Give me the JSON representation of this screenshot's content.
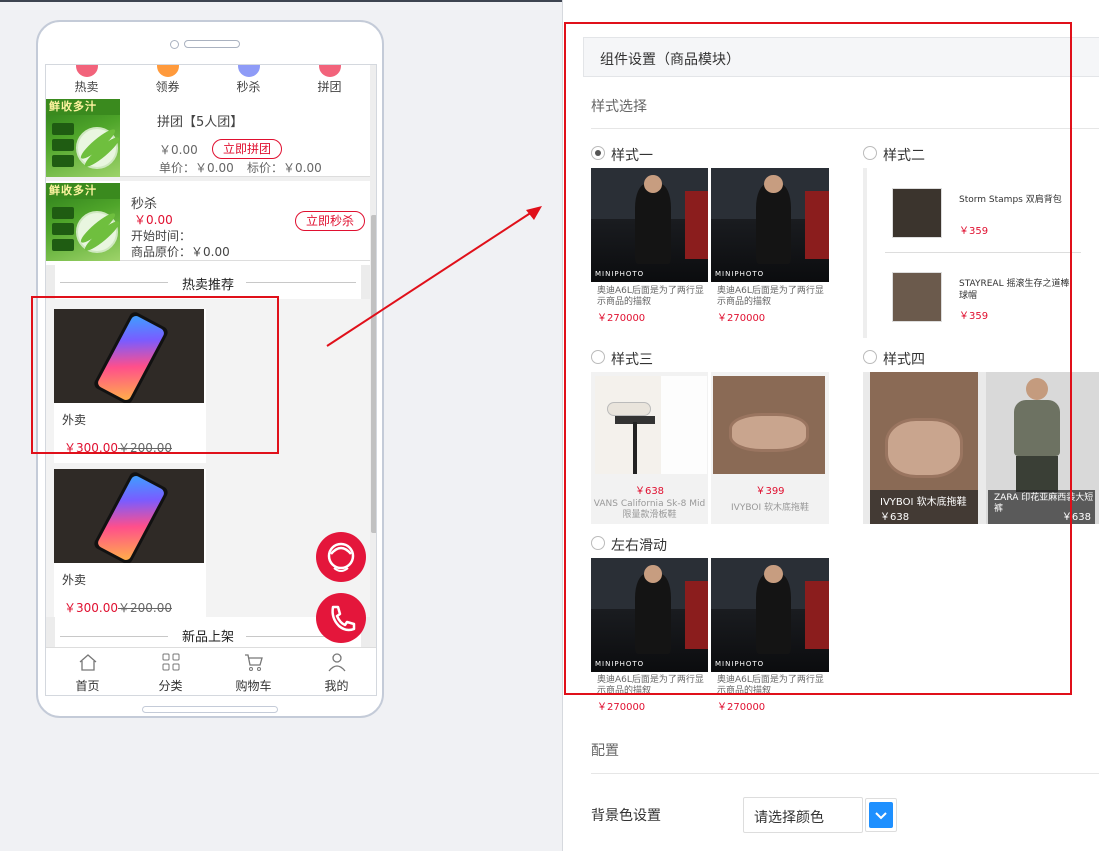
{
  "phone": {
    "top_nav": [
      {
        "label": "热卖",
        "color": "#f2637b"
      },
      {
        "label": "领券",
        "color": "#ff9a3c"
      },
      {
        "label": "秒杀",
        "color": "#8e9bf7"
      },
      {
        "label": "拼团",
        "color": "#f2637b"
      }
    ],
    "promo": {
      "group": {
        "image_text": "鲜收多汁",
        "title": "拼团【5人团】",
        "price": "￥0.00",
        "button": "立即拼团",
        "unit_price": "单价：￥0.00",
        "tag_price": "标价：￥0.00"
      },
      "flash": {
        "image_text": "鲜收多汁",
        "title": "秒杀",
        "price": "￥0.00",
        "start_time": "开始时间：",
        "original_price": "商品原价：￥0.00",
        "button": "立即秒杀"
      }
    },
    "section_hot": "热卖推荐",
    "goods": [
      {
        "name": "外卖",
        "price": "￥300.00",
        "old_price": "￥200.00"
      },
      {
        "name": "外卖",
        "price": "￥300.00",
        "old_price": "￥200.00"
      }
    ],
    "section_new": "新品上架",
    "tabbar": [
      {
        "label": "首页",
        "icon": "home-icon"
      },
      {
        "label": "分类",
        "icon": "grid-icon"
      },
      {
        "label": "购物车",
        "icon": "cart-icon"
      },
      {
        "label": "我的",
        "icon": "user-icon"
      }
    ],
    "float_buttons": [
      "customer-service-icon",
      "phone-call-icon"
    ]
  },
  "settings": {
    "panel_title": "组件设置（商品模块）",
    "style_group_title": "样式选择",
    "styles": {
      "s1": {
        "label": "样式一",
        "selected": true,
        "items": [
          {
            "caption": "奥迪A6L后面是为了两行显示商品的描叙",
            "price": "￥270000",
            "watermark": "MINIPHOTO"
          },
          {
            "caption": "奥迪A6L后面是为了两行显示商品的描叙",
            "price": "￥270000",
            "watermark": "MINIPHOTO"
          }
        ]
      },
      "s2": {
        "label": "样式二",
        "selected": false,
        "items": [
          {
            "name": "Storm Stamps 双肩背包",
            "price": "￥359"
          },
          {
            "name": "STAYREAL 摇滚生存之道棒球帽",
            "price": "￥359"
          }
        ]
      },
      "s3": {
        "label": "样式三",
        "selected": false,
        "items": [
          {
            "price": "￥638",
            "name": "VANS California Sk-8 Mid 限量款滑板鞋"
          },
          {
            "price": "￥399",
            "name": "IVYBOI 软木底拖鞋"
          }
        ]
      },
      "s4": {
        "label": "样式四",
        "selected": false,
        "items": [
          {
            "name": "IVYBOI 软木底拖鞋",
            "price": "￥638"
          },
          {
            "name": "ZARA 印花亚麻西装大短裤",
            "price": "￥638"
          }
        ]
      },
      "slide": {
        "label": "左右滑动",
        "selected": false,
        "items": [
          {
            "caption": "奥迪A6L后面是为了两行显示商品的描叙",
            "price": "￥270000",
            "watermark": "MINIPHOTO"
          },
          {
            "caption": "奥迪A6L后面是为了两行显示商品的描叙",
            "price": "￥270000",
            "watermark": "MINIPHOTO"
          }
        ]
      }
    },
    "config_group_title": "配置",
    "bg_color_label": "背景色设置",
    "bg_color_placeholder": "请选择颜色",
    "accent_color": "#1e90ff",
    "highlight_color": "#e0101a"
  }
}
